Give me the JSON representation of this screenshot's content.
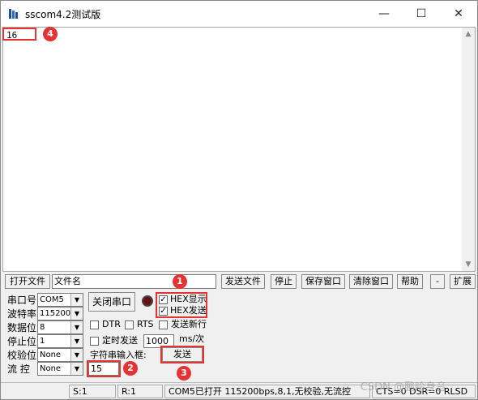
{
  "window": {
    "title": "sscom4.2测试版",
    "minimize_icon": "minimize-icon",
    "maximize_icon": "maximize-icon",
    "close_icon": "close-icon"
  },
  "receive": {
    "text": "16"
  },
  "toolbar": {
    "open_file": "打开文件",
    "file_name": "文件名",
    "send_file": "发送文件",
    "stop": "停止",
    "save_window": "保存窗口",
    "clear_window": "清除窗口",
    "help": "帮助",
    "dash": "-",
    "expand": "扩展"
  },
  "settings": {
    "port_label": "串口号",
    "port_value": "COM5",
    "baud_label": "波特率",
    "baud_value": "115200",
    "data_label": "数据位",
    "data_value": "8",
    "stop_label": "停止位",
    "stop_value": "1",
    "parity_label": "校验位",
    "parity_value": "None",
    "flow_label": "流 控",
    "flow_value": "None"
  },
  "controls": {
    "close_port": "关闭串口",
    "hex_display": "HEX显示",
    "hex_send": "HEX发送",
    "dtr": "DTR",
    "rts": "RTS",
    "send_newline": "发送新行",
    "timed_send": "定时发送",
    "interval": "1000",
    "interval_unit": "ms/次",
    "string_input_label": "字符串输入框:",
    "send": "发送",
    "send_text": "15"
  },
  "badges": [
    "1",
    "2",
    "3",
    "4"
  ],
  "status": {
    "s": "S:1",
    "r": "R:1",
    "info": "COM5已打开  115200bps,8,1,无校验,无流控",
    "lines": "CTS=0 DSR=0 RLSD"
  },
  "watermark": "CSDN @鹏哈身音",
  "colors": {
    "highlight": "#e53333",
    "led": "#6a1010"
  }
}
